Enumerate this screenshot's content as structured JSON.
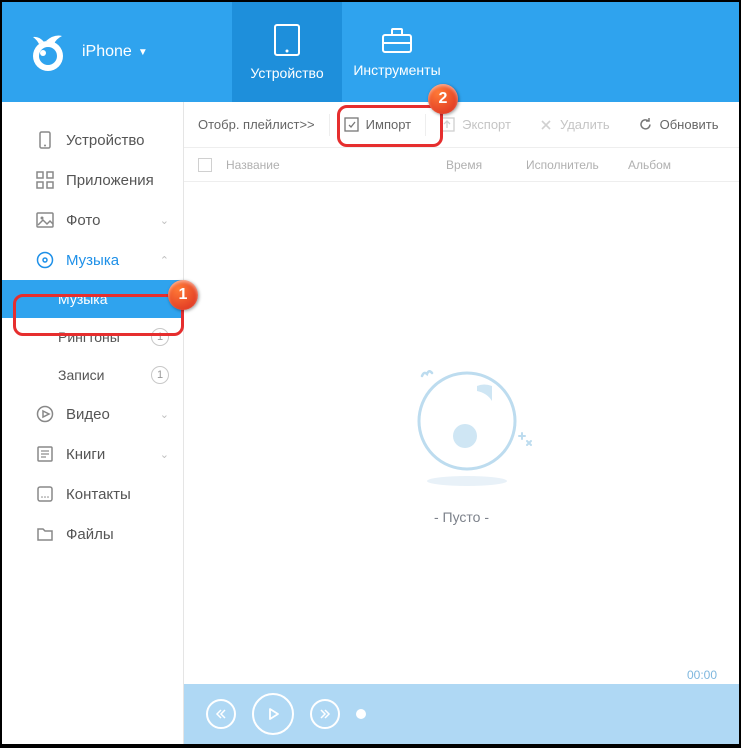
{
  "header": {
    "device_name": "iPhone",
    "tabs": {
      "device": "Устройство",
      "tools": "Инструменты"
    }
  },
  "sidebar": {
    "device": "Устройство",
    "apps": "Приложения",
    "photo": "Фото",
    "music": "Музыка",
    "music_sub": {
      "music": "Музыка",
      "ringtones": "Рингтоны",
      "recordings": "Записи"
    },
    "ringtones_count": "1",
    "recordings_count": "1",
    "video": "Видео",
    "books": "Книги",
    "contacts": "Контакты",
    "files": "Файлы"
  },
  "toolbar": {
    "show_playlist": "Отобр. плейлист>>",
    "import": "Импорт",
    "export": "Экспорт",
    "delete": "Удалить",
    "refresh": "Обновить"
  },
  "columns": {
    "name": "Название",
    "time": "Время",
    "artist": "Исполнитель",
    "album": "Альбом"
  },
  "empty_label": "- Пусто -",
  "player": {
    "current": "",
    "total": "00:00"
  },
  "callouts": {
    "one": "1",
    "two": "2"
  }
}
